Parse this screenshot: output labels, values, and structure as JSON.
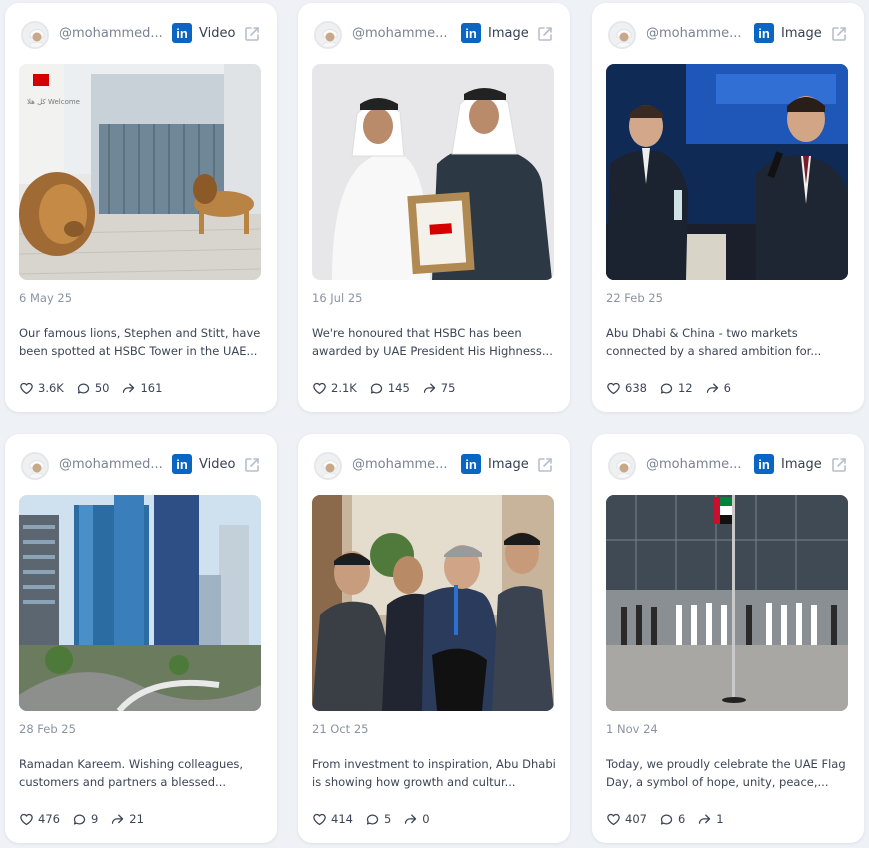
{
  "posts": [
    {
      "handle": "@mohammed...",
      "platform": "LinkedIn",
      "media_type": "Video",
      "date": "6 May 25",
      "caption": "Our famous lions, Stephen and Stitt, have been spotted at HSBC Tower in the UAE...",
      "likes": "3.6K",
      "comments": "50",
      "shares": "161",
      "image_sign": "كل هلا Welcome"
    },
    {
      "handle": "@mohamme...",
      "platform": "LinkedIn",
      "media_type": "Image",
      "date": "16 Jul 25",
      "caption": "We're honoured that HSBC has been awarded by UAE President His Highness...",
      "likes": "2.1K",
      "comments": "145",
      "shares": "75"
    },
    {
      "handle": "@mohamme...",
      "platform": "LinkedIn",
      "media_type": "Image",
      "date": "22 Feb 25",
      "caption": "Abu Dhabi & China - two markets connected by a shared ambition for...",
      "likes": "638",
      "comments": "12",
      "shares": "6"
    },
    {
      "handle": "@mohammed...",
      "platform": "LinkedIn",
      "media_type": "Video",
      "date": "28 Feb 25",
      "caption": "Ramadan Kareem. Wishing colleagues, customers and partners a blessed...",
      "likes": "476",
      "comments": "9",
      "shares": "21"
    },
    {
      "handle": "@mohamme...",
      "platform": "LinkedIn",
      "media_type": "Image",
      "date": "21 Oct 25",
      "caption": "From investment to inspiration, Abu Dhabi is showing how growth and cultur...",
      "likes": "414",
      "comments": "5",
      "shares": "0"
    },
    {
      "handle": "@mohamme...",
      "platform": "LinkedIn",
      "media_type": "Image",
      "date": "1 Nov 24",
      "caption": "Today, we proudly celebrate the UAE Flag Day, a symbol of hope, unity, peace,...",
      "likes": "407",
      "comments": "6",
      "shares": "1"
    }
  ],
  "colors": {
    "background": "#eef1f5",
    "card": "#ffffff",
    "linkedin": "#0a66c2",
    "muted_text": "#8a93a3"
  },
  "icons": {
    "linkedin": "linkedin-icon",
    "external": "external-link-icon",
    "like": "heart-icon",
    "comment": "comment-icon",
    "share": "share-icon"
  }
}
